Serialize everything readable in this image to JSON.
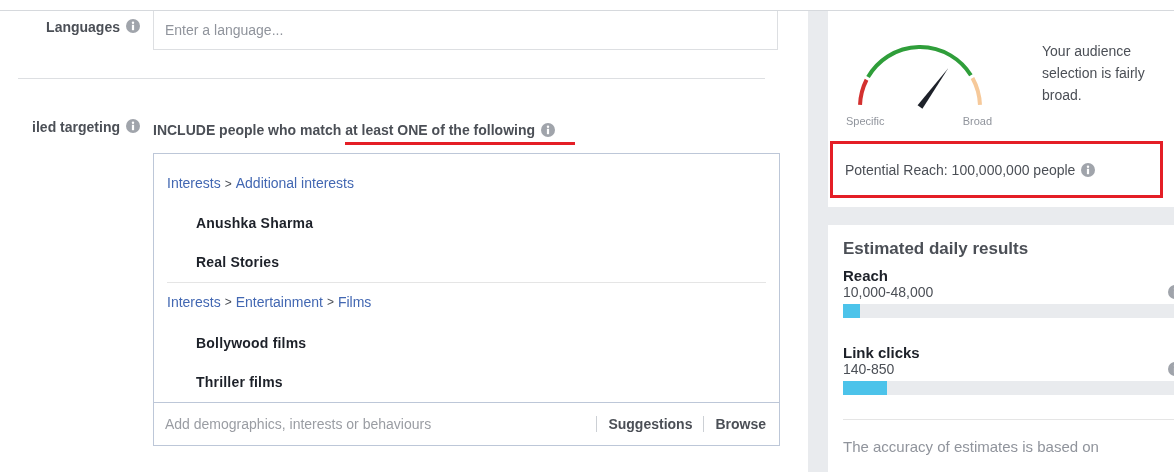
{
  "languages": {
    "label": "Languages",
    "placeholder": "Enter a language..."
  },
  "detailed_targeting": {
    "label": "iled targeting",
    "include_prefix": "INCLUDE people who match",
    "include_highlight": "at least ONE of the following",
    "groups": [
      {
        "path": [
          "Interests",
          "Additional interests"
        ],
        "items": [
          "Anushka Sharma",
          "Real Stories"
        ]
      },
      {
        "path": [
          "Interests",
          "Entertainment",
          "Films"
        ],
        "items": [
          "Bollywood films",
          "Thriller films"
        ]
      }
    ],
    "separator": ">",
    "placeholder": "Add demographics, interests or behaviours",
    "actions": [
      "Suggestions",
      "Browse"
    ]
  },
  "audience": {
    "specific_label": "Specific",
    "broad_label": "Broad",
    "description": "Your audience selection is fairly broad.",
    "potential_reach": "Potential Reach: 100,000,000 people"
  },
  "estimates": {
    "title": "Estimated daily results",
    "metrics": [
      {
        "name": "Reach",
        "reading": "10,000-48,000",
        "level": 0.05
      },
      {
        "name": "Link clicks",
        "reading": "140-850",
        "level": 0.13
      }
    ],
    "footnote": "The accuracy of estimates is based on"
  }
}
